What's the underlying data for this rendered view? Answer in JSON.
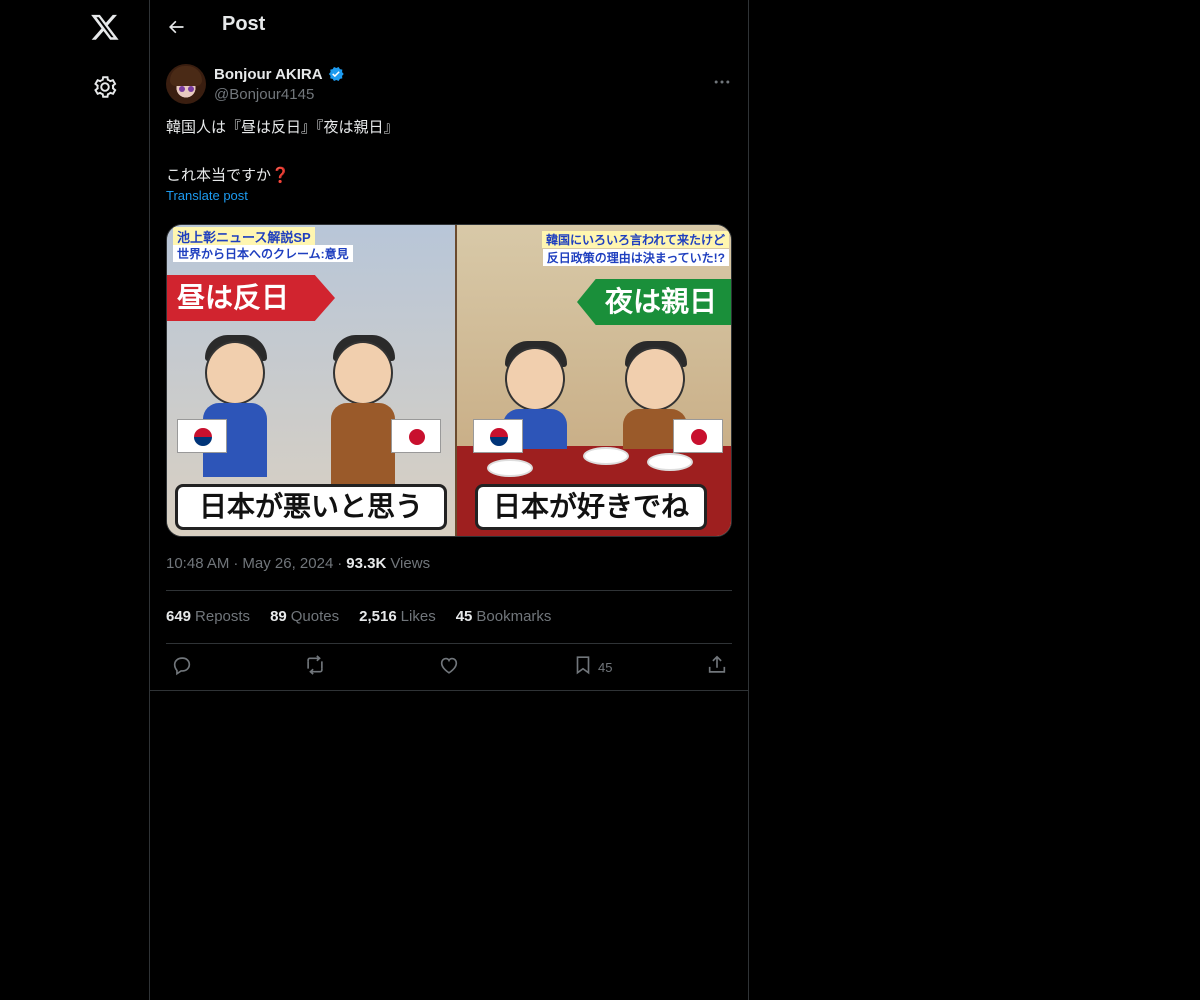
{
  "header": {
    "title": "Post"
  },
  "author": {
    "name": "Bonjour AKIRA",
    "handle": "@Bonjour4145"
  },
  "post": {
    "line1": "韓国人は『昼は反日』『夜は親日』",
    "line2": "これ本当ですか❓",
    "translate": "Translate post",
    "time": "10:48 AM",
    "dot1": "·",
    "date": "May 26, 2024",
    "dot2": "·",
    "views_count": "93.3K",
    "views_label": "Views"
  },
  "stats": {
    "reposts_count": "649",
    "reposts_label": "Reposts",
    "quotes_count": "89",
    "quotes_label": "Quotes",
    "likes_count": "2,516",
    "likes_label": "Likes",
    "bookmarks_count": "45",
    "bookmarks_label": "Bookmarks"
  },
  "actions": {
    "bookmark_count": "45"
  },
  "media": {
    "tv_title": "池上彰ニュース解説SP",
    "tv_subtitle": "世界から日本へのクレーム:意見",
    "tv_right1": "韓国にいろいろ言われて来たけど",
    "tv_right2": "反日政策の理由は決まっていた!?",
    "banner_left": "昼は反日",
    "banner_right": "夜は親日",
    "caption_left": "日本が悪いと思う",
    "caption_right": "日本が好きでね"
  },
  "icons": {
    "logo": "x-logo-icon",
    "settings": "gear-icon",
    "back": "back-arrow-icon",
    "verified": "verified-badge-icon",
    "more": "more-icon",
    "reply": "reply-icon",
    "repost": "repost-icon",
    "like": "heart-icon",
    "bookmark": "bookmark-icon",
    "share": "share-icon"
  },
  "colors": {
    "background": "#000000",
    "text": "#e7e9ea",
    "muted": "#71767b",
    "accent": "#1d9bf0",
    "border": "#2f3336"
  }
}
